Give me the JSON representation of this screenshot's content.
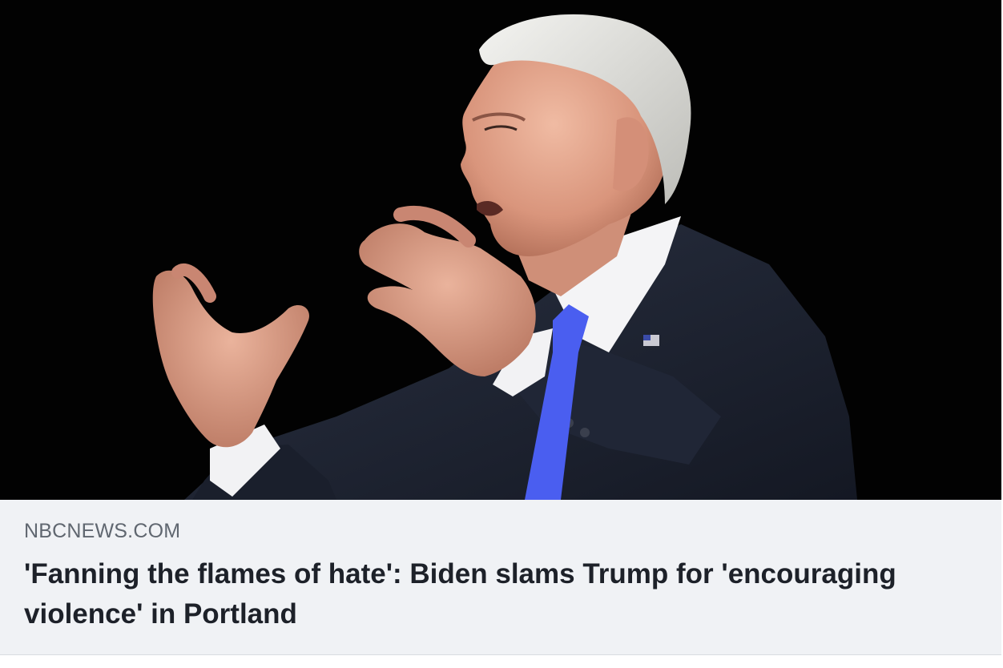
{
  "link_preview": {
    "domain": "NBCNEWS.COM",
    "headline": "'Fanning the flames of hate': Biden slams Trump for 'encouraging violence' in Portland"
  },
  "image": {
    "subject": "speaker-gesturing-photo"
  },
  "colors": {
    "image_background": "#020202",
    "caption_background": "#f0f2f5",
    "domain_text": "#606770",
    "headline_text": "#1d2129",
    "suit": "#1c2130",
    "tie": "#4a5ef0",
    "skin": "#e2a58e",
    "hair": "#e9e9e6"
  }
}
